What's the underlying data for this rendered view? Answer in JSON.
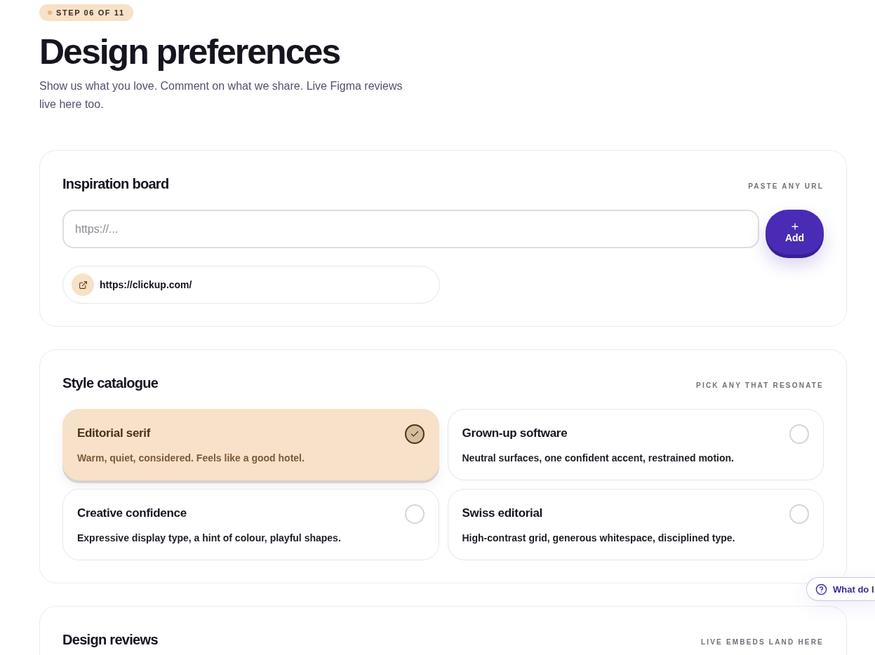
{
  "step_badge": {
    "label": "STEP 06 OF 11"
  },
  "header": {
    "title": "Design preferences",
    "subtitle": "Show us what you love. Comment on what we share. Live Figma reviews live here too."
  },
  "inspiration_board": {
    "title": "Inspiration board",
    "hint": "PASTE ANY URL",
    "url_field": {
      "placeholder": "https://..."
    },
    "add_button": {
      "label": "Add"
    },
    "links": [
      {
        "url": "https://clickup.com/"
      }
    ]
  },
  "style_catalogue": {
    "title": "Style catalogue",
    "hint": "PICK ANY THAT RESONATE",
    "styles": [
      {
        "title": "Editorial serif",
        "description": "Warm, quiet, considered. Feels like a good hotel.",
        "selected": true
      },
      {
        "title": "Grown-up software",
        "description": "Neutral surfaces, one confident accent, restrained motion.",
        "selected": false
      },
      {
        "title": "Creative confidence",
        "description": "Expressive display type, a hint of colour, playful shapes.",
        "selected": false
      },
      {
        "title": "Swiss editorial",
        "description": "High-contrast grid, generous whitespace, disciplined type.",
        "selected": false
      }
    ]
  },
  "design_reviews": {
    "title": "Design reviews",
    "hint": "LIVE EMBEDS LAND HERE"
  },
  "help_button": {
    "label": "What do I"
  }
}
